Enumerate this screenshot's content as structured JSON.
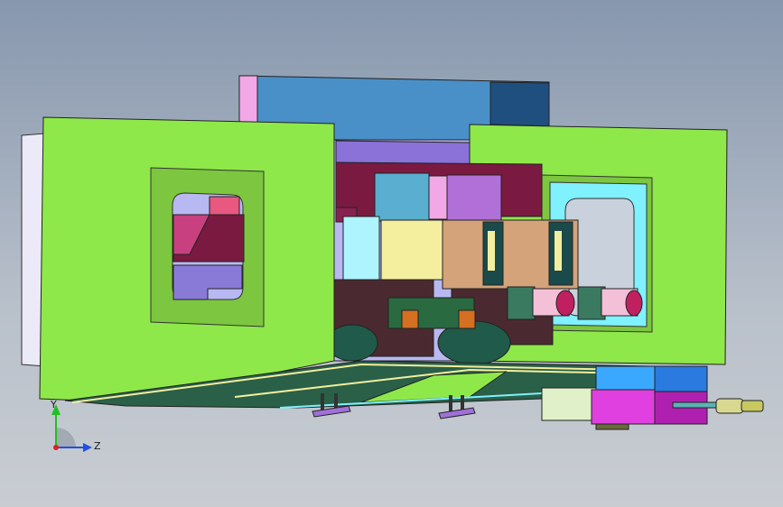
{
  "viewport": {
    "background_top": "#8797ae",
    "background_bottom": "#c9cdd2"
  },
  "model": {
    "palette": {
      "frame_green": "#8fe84a",
      "frame_dark_green": "#7dc63f",
      "steel_blue": "#4a90c8",
      "navy": "#1f4f7f",
      "pink": "#f2a8e6",
      "maroon": "#6b1530",
      "tan": "#d4a37a",
      "cyan": "#7ff1ff",
      "violet": "#a070d8",
      "magenta": "#e020d0",
      "brown": "#4a2a30"
    }
  },
  "triad": {
    "y_label": "Y",
    "z_label": "Z",
    "y_color": "#20c020",
    "z_color": "#2050e0",
    "origin_color": "#e02020"
  }
}
